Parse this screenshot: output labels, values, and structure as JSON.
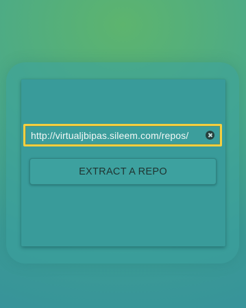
{
  "form": {
    "url_value": "http://virtualjbipas.sileem.com/repos/",
    "clear_icon": "clear-icon",
    "extract_label": "EXTRACT A REPO"
  },
  "colors": {
    "background_top": "#5db46e",
    "background_bottom": "#37939a",
    "card": "#399b9a",
    "input_focus_border": "#f6cf3f",
    "button_text": "#1f3330"
  }
}
